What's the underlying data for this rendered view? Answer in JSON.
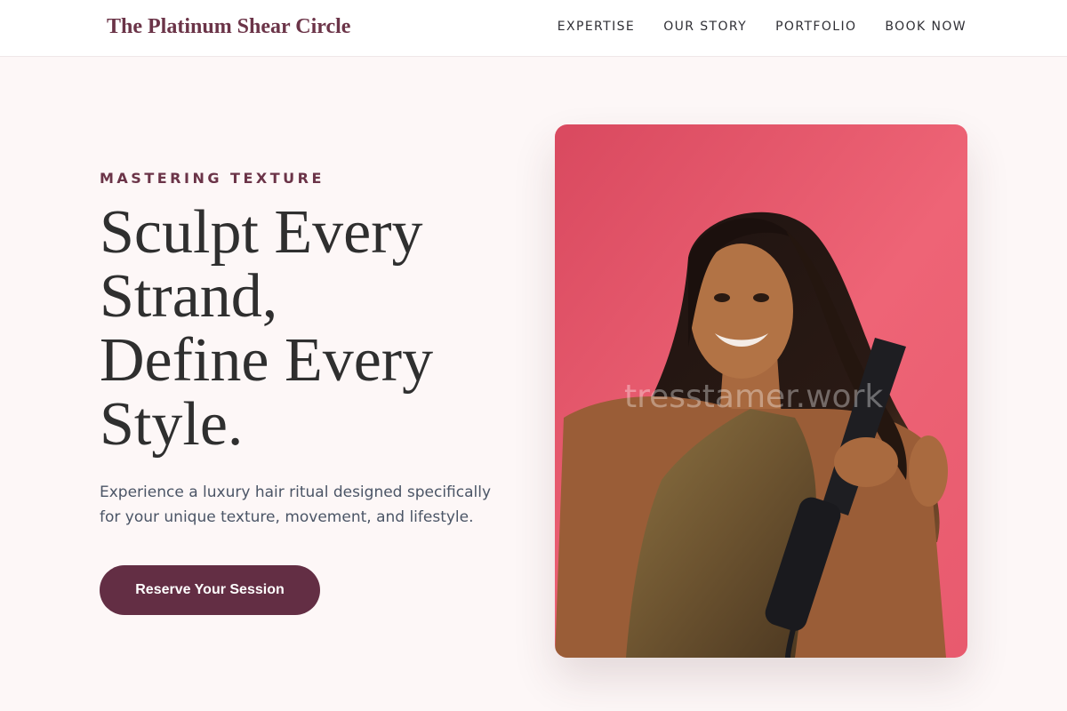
{
  "header": {
    "brand": "The Platinum Shear Circle",
    "nav": [
      {
        "label": "EXPERTISE"
      },
      {
        "label": "OUR STORY"
      },
      {
        "label": "PORTFOLIO"
      },
      {
        "label": "BOOK NOW"
      }
    ]
  },
  "hero": {
    "eyebrow": "MASTERING TEXTURE",
    "headline_lines": [
      "Sculpt Every",
      "Strand,",
      "Define Every",
      "Style."
    ],
    "subtext_lines": [
      "Experience a luxury hair ritual designed specifically",
      "for your unique texture, movement, and lifestyle."
    ],
    "cta_label": "Reserve Your Session",
    "image": {
      "description": "smiling woman with long dark straight hair holding a flat iron against a pink background",
      "watermark": "tresstamer.work"
    }
  },
  "colors": {
    "brand": "#6b3448",
    "cta_background": "#632e44",
    "page_background": "#fdf7f7",
    "photo_background": "#e85d72"
  }
}
